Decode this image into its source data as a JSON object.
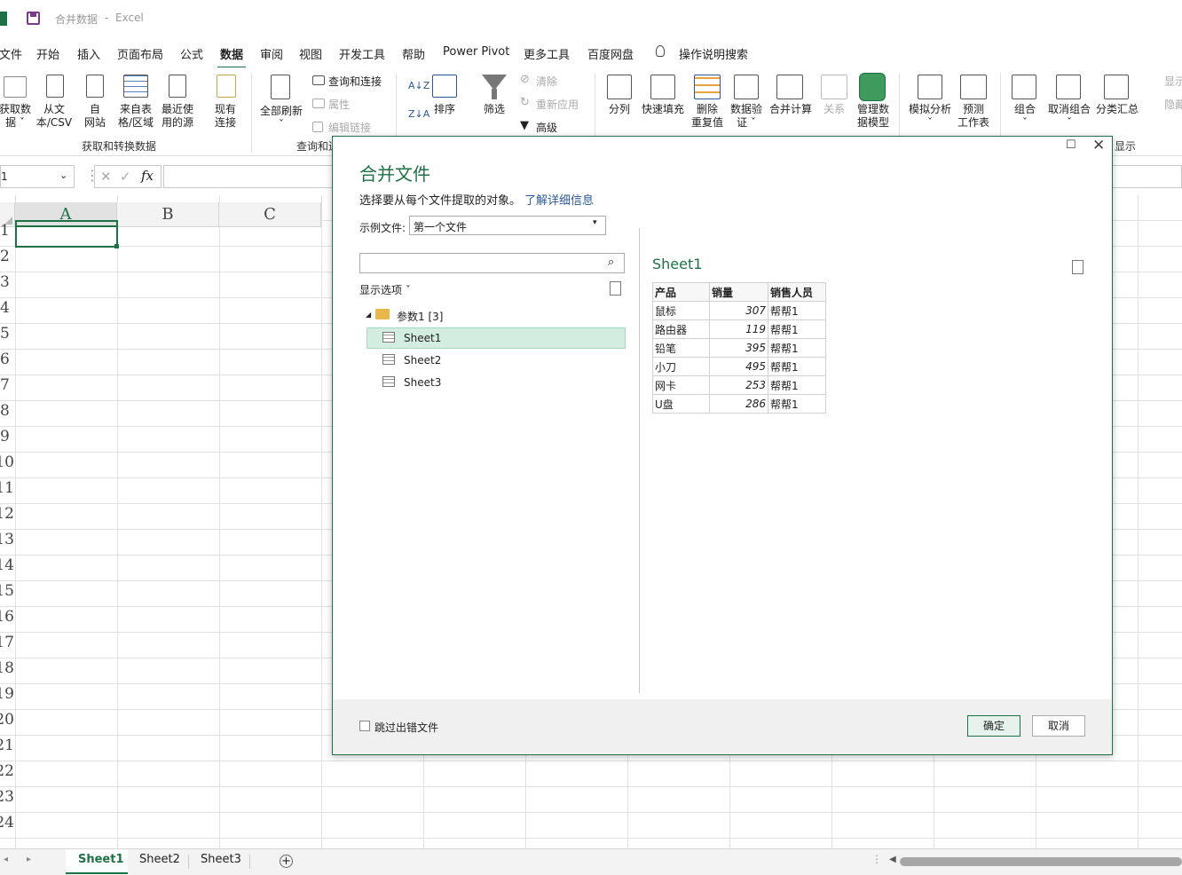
{
  "title": {
    "doc": "合并数据",
    "sep": "-",
    "app": "Excel"
  },
  "tabs": [
    "文件",
    "开始",
    "插入",
    "页面布局",
    "公式",
    "数据",
    "审阅",
    "视图",
    "开发工具",
    "帮助",
    "Power Pivot",
    "更多工具",
    "百度网盘",
    "操作说明搜索"
  ],
  "active_tab": "数据",
  "ribbon": {
    "get_data": "获取数\n据 ˇ",
    "from_text": "从文\n本/CSV",
    "from_web": "自\n网站",
    "from_table": "来自表\n格/区域",
    "recent_sources": "最近使\n用的源",
    "existing_conn": "现有\n连接",
    "group_get": "获取和转换数据",
    "refresh_all": "全部刷新\nˇ",
    "queries_conn": "查询和连接",
    "properties": "属性",
    "edit_links": "编辑链接",
    "group_query": "查询和连",
    "sort": "排序",
    "filter": "筛选",
    "clear": "清除",
    "reapply": "重新应用",
    "advanced": "高级",
    "text_to_cols": "分列",
    "flash_fill": "快速填充",
    "remove_dup": "删除\n重复值",
    "data_valid": "数据验\n证 ˇ",
    "consolidate": "合并计算",
    "relationships": "关系",
    "data_model": "管理数\n据模型",
    "whatif": "模拟分析\nˇ",
    "forecast": "预测\n工作表",
    "group_btn": "组合\nˇ",
    "ungroup": "取消组合\nˇ",
    "subtotal": "分类汇总",
    "show": "显示",
    "hide": "隐藏",
    "group_show": "显示"
  },
  "namebox": "1",
  "fx": "fx",
  "columns": [
    "A",
    "B",
    "C"
  ],
  "row_labels": [
    "1",
    "2",
    "3",
    "4",
    "5",
    "6",
    "7",
    "8",
    "9",
    "10",
    "11",
    "12",
    "13",
    "14",
    "15",
    "16",
    "17",
    "18",
    "19",
    "20",
    "21",
    "22",
    "23",
    "24"
  ],
  "dialog": {
    "title": "合并文件",
    "subtitle": "选择要从每个文件提取的对象。",
    "learn_more": "了解详细信息",
    "sample_label": "示例文件:",
    "sample_value": "第一个文件",
    "search_placeholder": "",
    "display_options": "显示选项 ˇ",
    "folder": "参数1 [3]",
    "sheets": [
      "Sheet1",
      "Sheet2",
      "Sheet3"
    ],
    "preview_title": "Sheet1",
    "preview_headers": [
      "产品",
      "销量",
      "销售人员"
    ],
    "preview_rows": [
      [
        "鼠标",
        "307",
        "帮帮1"
      ],
      [
        "路由器",
        "119",
        "帮帮1"
      ],
      [
        "铅笔",
        "395",
        "帮帮1"
      ],
      [
        "小刀",
        "495",
        "帮帮1"
      ],
      [
        "网卡",
        "253",
        "帮帮1"
      ],
      [
        "U盘",
        "286",
        "帮帮1"
      ]
    ],
    "skip_errors": "跳过出错文件",
    "ok": "确定",
    "cancel": "取消"
  },
  "sheet_tabs": [
    "Sheet1",
    "Sheet2",
    "Sheet3"
  ],
  "colors": {
    "accent": "#1e7145",
    "selected_row": "#d3ede0",
    "link": "#2b579a",
    "arrow": "#e8332a"
  }
}
